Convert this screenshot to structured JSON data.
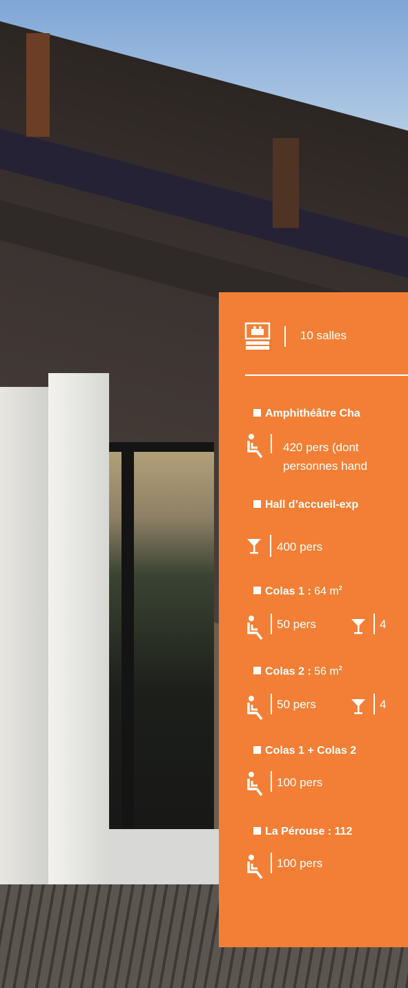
{
  "panel": {
    "rooms": "10 salles",
    "amphi": {
      "title": "Amphithéâtre Cha",
      "line1": "420 pers (dont",
      "line2": "personnes hand"
    },
    "hall": {
      "title": "Hall d’accueil-exp",
      "cocktail": "400 pers"
    },
    "colas1": {
      "title": "Colas 1 :",
      "area": "64 m",
      "seated": "50 pers",
      "cocktail": "4"
    },
    "colas2": {
      "title": "Colas 2 :",
      "area": "56 m",
      "seated": "50 pers",
      "cocktail": "4"
    },
    "colas12": {
      "title": "Colas 1 + Colas 2",
      "seated": "100 pers"
    },
    "perouse": {
      "title": "La Pérouse :",
      "area": "112",
      "seated": "100 pers"
    },
    "sup": "2"
  },
  "icons": [
    "conference-room-icon",
    "seated-person-icon",
    "cocktail-glass-icon"
  ],
  "colors": {
    "panel": "#f37f36",
    "text": "#ffffff"
  }
}
